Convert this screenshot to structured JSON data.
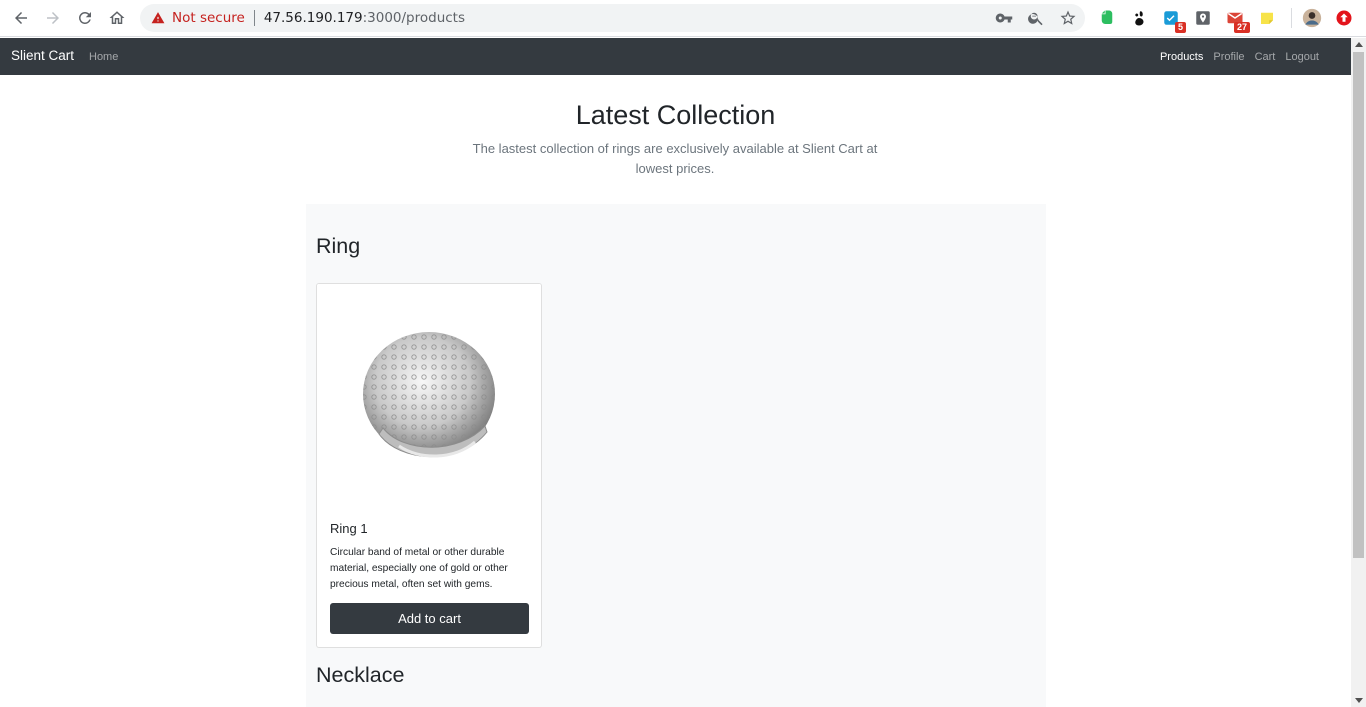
{
  "browser": {
    "security_label": "Not secure",
    "url_host": "47.56.190.179",
    "url_path": ":3000/products",
    "extension_badges": {
      "checklist": "5",
      "mail": "27"
    }
  },
  "navbar": {
    "brand": "Slient Cart",
    "home": "Home",
    "links": [
      "Products",
      "Profile",
      "Cart",
      "Logout"
    ],
    "active": "Products"
  },
  "hero": {
    "title": "Latest Collection",
    "lead": "The lastest collection of rings are exclusively available at Slient Cart at lowest prices."
  },
  "categories": [
    {
      "name": "Ring",
      "products": [
        {
          "title": "Ring 1",
          "description": "Circular band of metal or other durable material, especially one of gold or other precious metal, often set with gems.",
          "button": "Add to cart"
        }
      ]
    },
    {
      "name": "Necklace",
      "products": []
    }
  ],
  "colors": {
    "navbar_bg": "#343a40",
    "album_bg": "#f8f9fa",
    "not_secure": "#c5221f"
  }
}
